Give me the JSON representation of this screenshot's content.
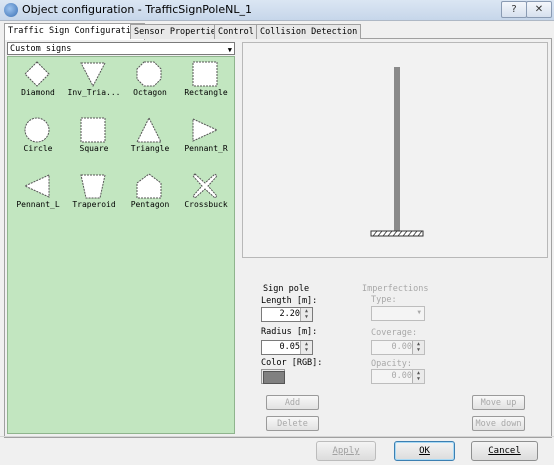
{
  "window": {
    "title": "Object configuration - TrafficSignPoleNL_1",
    "help": "?",
    "close": "✕"
  },
  "tabs": [
    {
      "label": "Traffic Sign Configuration"
    },
    {
      "label": "Sensor Properties"
    },
    {
      "label": "Control"
    },
    {
      "label": "Collision Detection"
    }
  ],
  "sign_category": {
    "selected": "Custom signs"
  },
  "shapes": [
    {
      "label": "Diamond"
    },
    {
      "label": "Inv_Tria..."
    },
    {
      "label": "Octagon"
    },
    {
      "label": "Rectangle"
    },
    {
      "label": "Circle"
    },
    {
      "label": "Square"
    },
    {
      "label": "Triangle"
    },
    {
      "label": "Pennant_R"
    },
    {
      "label": "Pennant_L"
    },
    {
      "label": "Traperoid"
    },
    {
      "label": "Pentagon"
    },
    {
      "label": "Crossbuck"
    }
  ],
  "sign_pole": {
    "title": "Sign pole",
    "length_label": "Length [m]:",
    "length_value": "2.20",
    "radius_label": "Radius [m]:",
    "radius_value": "0.05",
    "color_label": "Color [RGB]:",
    "color_hex": "#808080"
  },
  "imperfections": {
    "title": "Imperfections",
    "type_label": "Type:",
    "type_value": "",
    "coverage_label": "Coverage:",
    "coverage_value": "0.00",
    "opacity_label": "Opacity:",
    "opacity_value": "0.00"
  },
  "buttons": {
    "add": "Add",
    "delete": "Delete",
    "move_up": "Move up",
    "move_down": "Move down",
    "apply": "Apply",
    "ok": "OK",
    "cancel": "Cancel"
  }
}
